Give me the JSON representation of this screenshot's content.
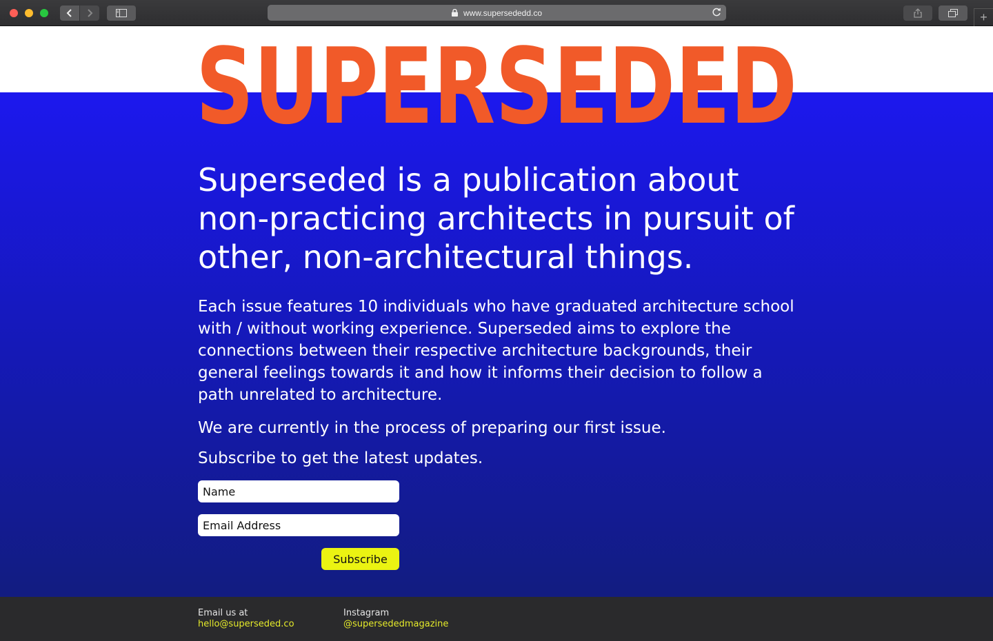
{
  "browser": {
    "url": "www.supersededd.co"
  },
  "page": {
    "logo": "SUPERSEDED",
    "headline": "Superseded is a publication about non-practicing architects in pursuit of other, non-architectural things.",
    "paragraph1": "Each issue features 10 individuals who have graduated architecture school with / without working experience. Superseded aims to explore the connections between their respective architecture backgrounds, their general feelings towards it and how it informs their decision to follow a path unrelated to architecture.",
    "paragraph2": "We are currently in the process of preparing our first issue.",
    "paragraph3": "Subscribe to get the latest updates."
  },
  "form": {
    "name_placeholder": "Name",
    "email_placeholder": "Email Address",
    "subscribe_label": "Subscribe"
  },
  "footer": {
    "email_label": "Email us at",
    "email_value": "hello@superseded.co",
    "instagram_label": "Instagram",
    "instagram_value": "@supersededmagazine"
  },
  "colors": {
    "logo": "#f15a29",
    "hero_top": "#1c18ee",
    "hero_bottom": "#121c80",
    "button": "#ebf312",
    "footer_link": "#e5ea2a"
  },
  "icons": [
    "lock-icon",
    "reload-icon",
    "back-icon",
    "forward-icon",
    "sidebar-icon",
    "share-icon",
    "tabs-icon",
    "new-tab-icon"
  ]
}
